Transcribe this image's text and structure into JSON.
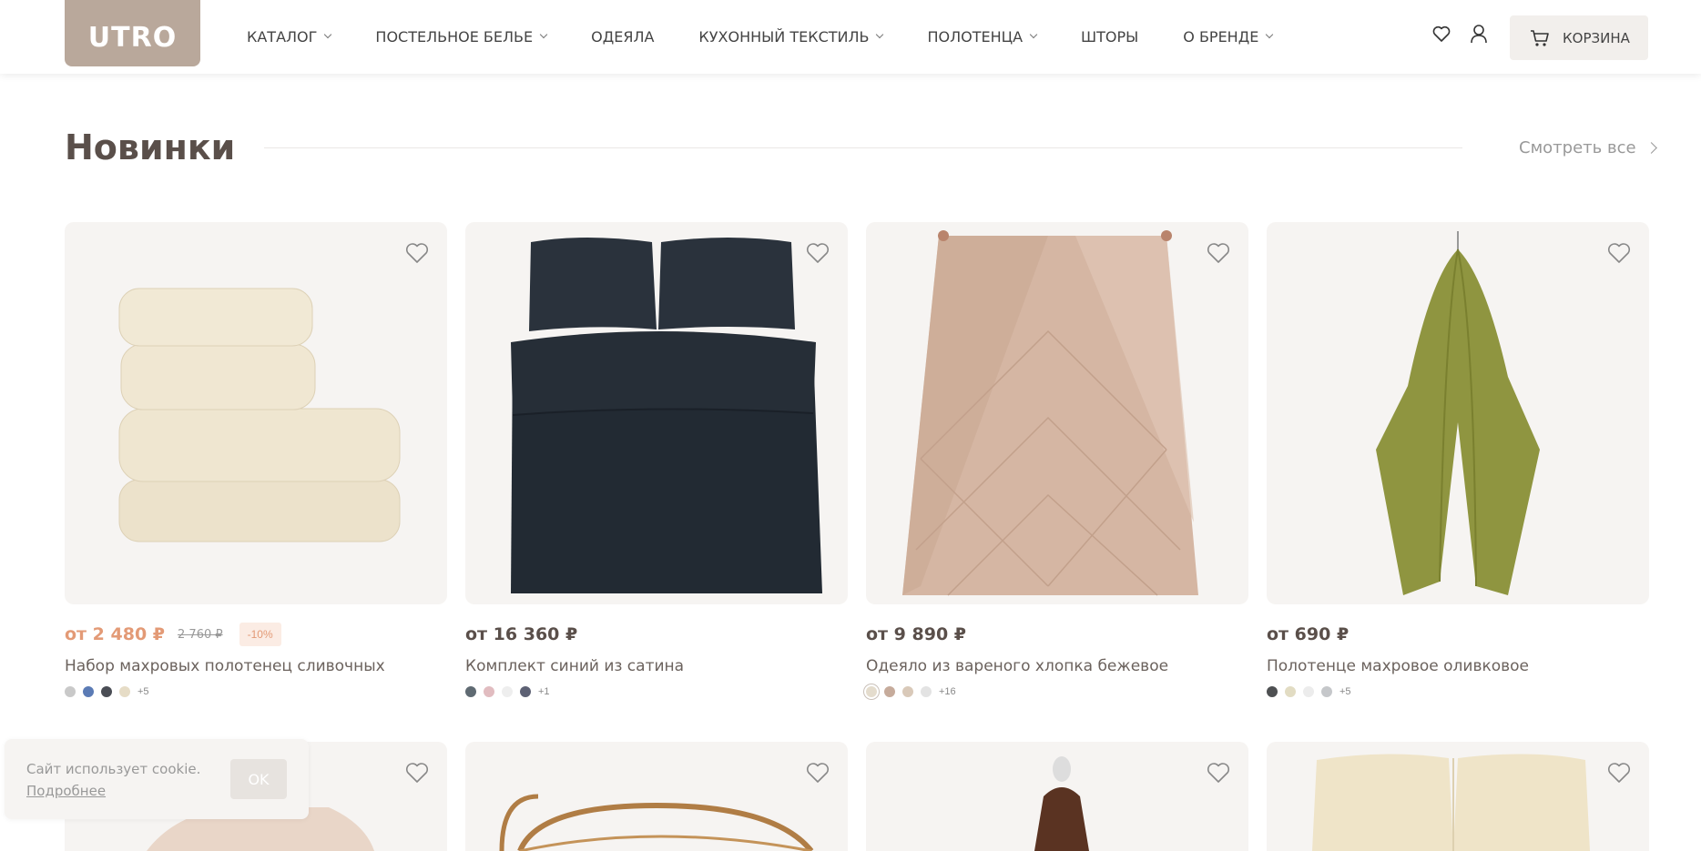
{
  "brand": {
    "logo": "UTRO"
  },
  "nav": [
    {
      "label": "КАТАЛОГ",
      "dropdown": true
    },
    {
      "label": "ПОСТЕЛЬНОЕ БЕЛЬЕ",
      "dropdown": true
    },
    {
      "label": "ОДЕЯЛА",
      "dropdown": false
    },
    {
      "label": "КУХОННЫЙ ТЕКСТИЛЬ",
      "dropdown": true
    },
    {
      "label": "ПОЛОТЕНЦА",
      "dropdown": true
    },
    {
      "label": "ШТОРЫ",
      "dropdown": false
    },
    {
      "label": "О БРЕНДЕ",
      "dropdown": true
    }
  ],
  "header": {
    "icons": [
      "heart-icon",
      "user-icon"
    ],
    "cart_label": "КОРЗИНА"
  },
  "section": {
    "title": "Новинки",
    "view_all": "Смотреть все"
  },
  "products": [
    {
      "price": "от 2 480 ₽",
      "old_price": "2 760 ₽",
      "discount": "-10%",
      "name": "Набор махровых полотенец сливочных",
      "swatches": [
        "#c9c9c9",
        "#5b7bb5",
        "#4a4d55",
        "#e6dcc6"
      ],
      "more": "+5",
      "image": "towel-stack"
    },
    {
      "price": "от 16 360 ₽",
      "name": "Комплект синий из сатина",
      "swatches": [
        "#5f6a72",
        "#e1bcc0",
        "#eeeeee",
        "#5d6174"
      ],
      "more": "+1",
      "image": "bedding-dark"
    },
    {
      "price": "от 9 890 ₽",
      "name": "Одеяло из вареного хлопка бежевое",
      "swatches": [
        "#e4dccd",
        "#c6ab9b",
        "#d9c9b9",
        "#e3e3e3"
      ],
      "more": "+16",
      "image": "blanket-beige"
    },
    {
      "price": "от 690 ₽",
      "name": "Полотенце махровое оливковое",
      "swatches": [
        "#4e5052",
        "#e2dcc3",
        "#ececec",
        "#c5c7ca"
      ],
      "more": "+5",
      "image": "towel-olive"
    }
  ],
  "colors": {
    "logo_bg": "#b9a89b",
    "sale_price": "#e39a76",
    "card_bg": "#f6f4f2"
  },
  "cookie": {
    "text": "Сайт использует cookie.",
    "link": "Подробнее",
    "ok": "OK"
  }
}
